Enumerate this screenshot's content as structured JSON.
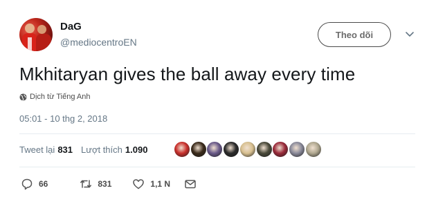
{
  "user": {
    "display_name": "DaG",
    "handle": "@mediocentroEN"
  },
  "follow_button_label": "Theo dõi",
  "tweet": {
    "text": "Mkhitaryan gives the ball away every time",
    "translate_label": "Dịch từ Tiếng Anh",
    "timestamp": "05:01 - 10 thg 2, 2018"
  },
  "stats": {
    "retweets_label": "Tweet lại",
    "retweets": "831",
    "likes_label": "Lượt thích",
    "likes": "1.090"
  },
  "likers": [
    {
      "name": "liker-avatar-1",
      "color": "#c9302c"
    },
    {
      "name": "liker-avatar-2",
      "color": "#3a2a1a"
    },
    {
      "name": "liker-avatar-3",
      "color": "#6a5a8a"
    },
    {
      "name": "liker-avatar-4",
      "color": "#2a2a2a"
    },
    {
      "name": "liker-avatar-5",
      "color": "#d8c090"
    },
    {
      "name": "liker-avatar-6",
      "color": "#4a4a3a"
    },
    {
      "name": "liker-avatar-7",
      "color": "#9a2a3a"
    },
    {
      "name": "liker-avatar-8",
      "color": "#8a8a9a"
    },
    {
      "name": "liker-avatar-9",
      "color": "#b0a890"
    }
  ],
  "actions": {
    "replies": "66",
    "retweets": "831",
    "likes": "1,1 N"
  }
}
